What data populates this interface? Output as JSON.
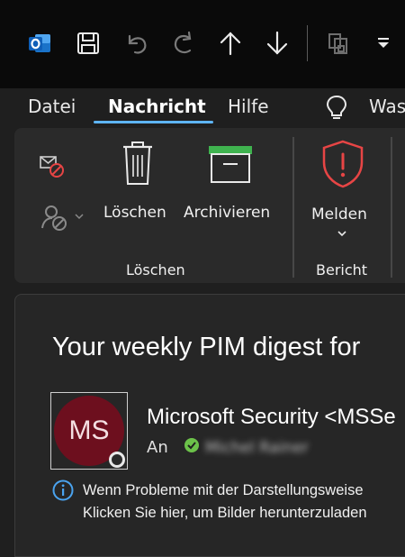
{
  "quick_access": {
    "icons": [
      "outlook-logo-icon",
      "save-icon",
      "undo-icon",
      "redo-icon",
      "move-up-icon",
      "move-down-icon",
      "print-preview-icon",
      "customize-dropdown-icon"
    ]
  },
  "tabs": [
    {
      "label": "Datei"
    },
    {
      "label": "Nachricht",
      "active": true
    },
    {
      "label": "Hilfe"
    }
  ],
  "tell_me": {
    "label": "Was"
  },
  "ribbon": {
    "groups": [
      {
        "label": "Löschen",
        "buttons": [
          "Löschen",
          "Archivieren"
        ]
      },
      {
        "label": "Bericht",
        "buttons": [
          "Melden"
        ]
      }
    ]
  },
  "message": {
    "subject": "Your weekly PIM digest for",
    "avatar_initials": "MS",
    "sender": "Microsoft Security <MSSe",
    "to_label": "An",
    "to_recipient": "Michel Rainer",
    "info_line1": "Wenn Probleme mit der Darstellungsweise",
    "info_line2": "Klicken Sie hier, um Bilder herunterzuladen"
  },
  "colors": {
    "accent": "#5eb5f7",
    "report_red": "#e74545",
    "archive_green": "#3fb34f",
    "avatar_bg": "#6d0f1e"
  }
}
